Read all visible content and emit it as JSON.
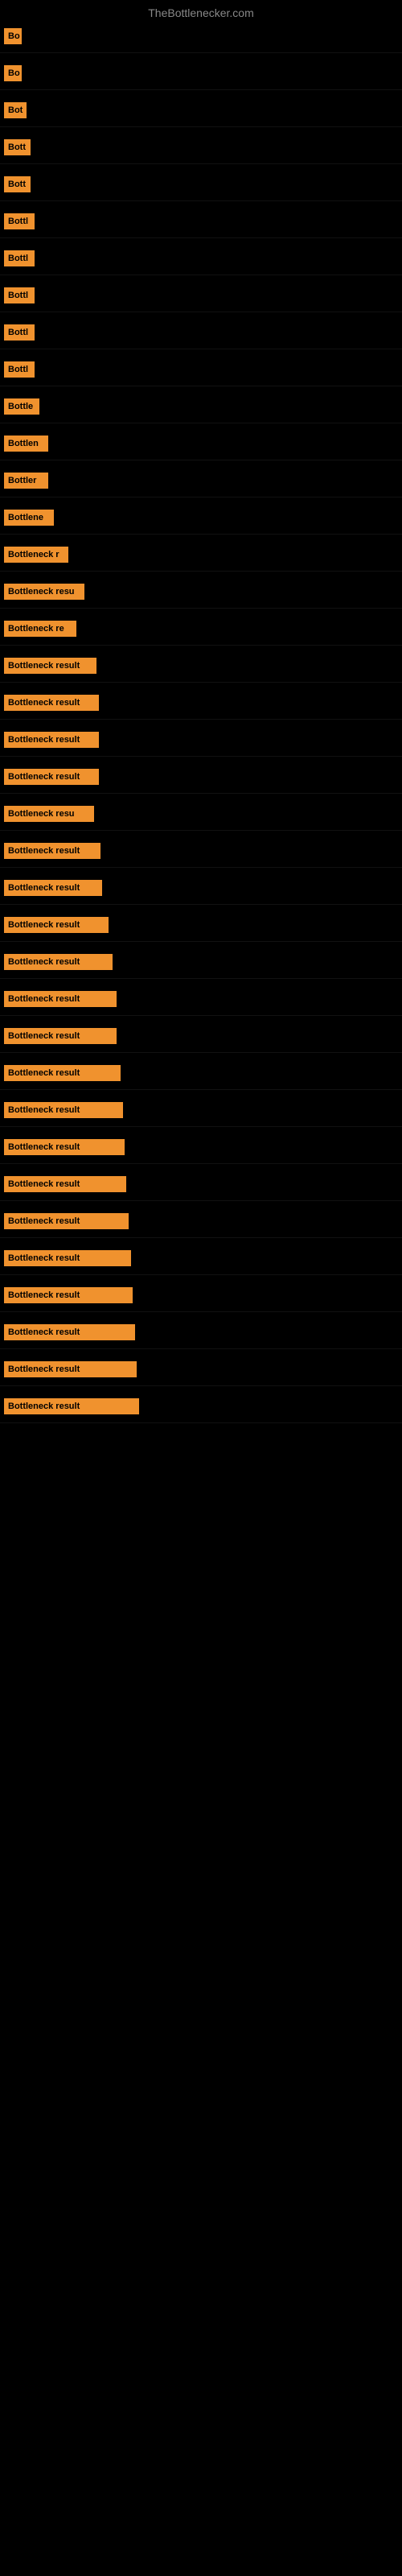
{
  "site": {
    "title": "TheBottlenecker.com"
  },
  "items": [
    {
      "label": "Bo",
      "width": 22,
      "marginTop": 0
    },
    {
      "label": "Bo",
      "width": 22,
      "marginTop": 5
    },
    {
      "label": "Bot",
      "width": 28,
      "marginTop": 5
    },
    {
      "label": "Bott",
      "width": 33,
      "marginTop": 5
    },
    {
      "label": "Bott",
      "width": 33,
      "marginTop": 5
    },
    {
      "label": "Bottl",
      "width": 38,
      "marginTop": 5
    },
    {
      "label": "Bottl",
      "width": 38,
      "marginTop": 5
    },
    {
      "label": "Bottl",
      "width": 38,
      "marginTop": 5
    },
    {
      "label": "Bottl",
      "width": 38,
      "marginTop": 5
    },
    {
      "label": "Bottl",
      "width": 38,
      "marginTop": 5
    },
    {
      "label": "Bottle",
      "width": 44,
      "marginTop": 5
    },
    {
      "label": "Bottlen",
      "width": 55,
      "marginTop": 5
    },
    {
      "label": "Bottler",
      "width": 55,
      "marginTop": 5
    },
    {
      "label": "Bottlene",
      "width": 62,
      "marginTop": 5
    },
    {
      "label": "Bottleneck r",
      "width": 80,
      "marginTop": 5
    },
    {
      "label": "Bottleneck resu",
      "width": 100,
      "marginTop": 5
    },
    {
      "label": "Bottleneck re",
      "width": 90,
      "marginTop": 5
    },
    {
      "label": "Bottleneck result",
      "width": 115,
      "marginTop": 5
    },
    {
      "label": "Bottleneck result",
      "width": 118,
      "marginTop": 5
    },
    {
      "label": "Bottleneck result",
      "width": 118,
      "marginTop": 5
    },
    {
      "label": "Bottleneck result",
      "width": 118,
      "marginTop": 5
    },
    {
      "label": "Bottleneck resu",
      "width": 112,
      "marginTop": 5
    },
    {
      "label": "Bottleneck result",
      "width": 120,
      "marginTop": 5
    },
    {
      "label": "Bottleneck result",
      "width": 122,
      "marginTop": 5
    },
    {
      "label": "Bottleneck result",
      "width": 130,
      "marginTop": 5
    },
    {
      "label": "Bottleneck result",
      "width": 135,
      "marginTop": 5
    },
    {
      "label": "Bottleneck result",
      "width": 140,
      "marginTop": 5
    },
    {
      "label": "Bottleneck result",
      "width": 140,
      "marginTop": 5
    },
    {
      "label": "Bottleneck result",
      "width": 145,
      "marginTop": 5
    },
    {
      "label": "Bottleneck result",
      "width": 148,
      "marginTop": 5
    },
    {
      "label": "Bottleneck result",
      "width": 150,
      "marginTop": 5
    },
    {
      "label": "Bottleneck result",
      "width": 152,
      "marginTop": 5
    },
    {
      "label": "Bottleneck result",
      "width": 155,
      "marginTop": 5
    },
    {
      "label": "Bottleneck result",
      "width": 158,
      "marginTop": 5
    },
    {
      "label": "Bottleneck result",
      "width": 160,
      "marginTop": 5
    },
    {
      "label": "Bottleneck result",
      "width": 163,
      "marginTop": 5
    },
    {
      "label": "Bottleneck result",
      "width": 165,
      "marginTop": 5
    },
    {
      "label": "Bottleneck result",
      "width": 168,
      "marginTop": 5
    }
  ]
}
